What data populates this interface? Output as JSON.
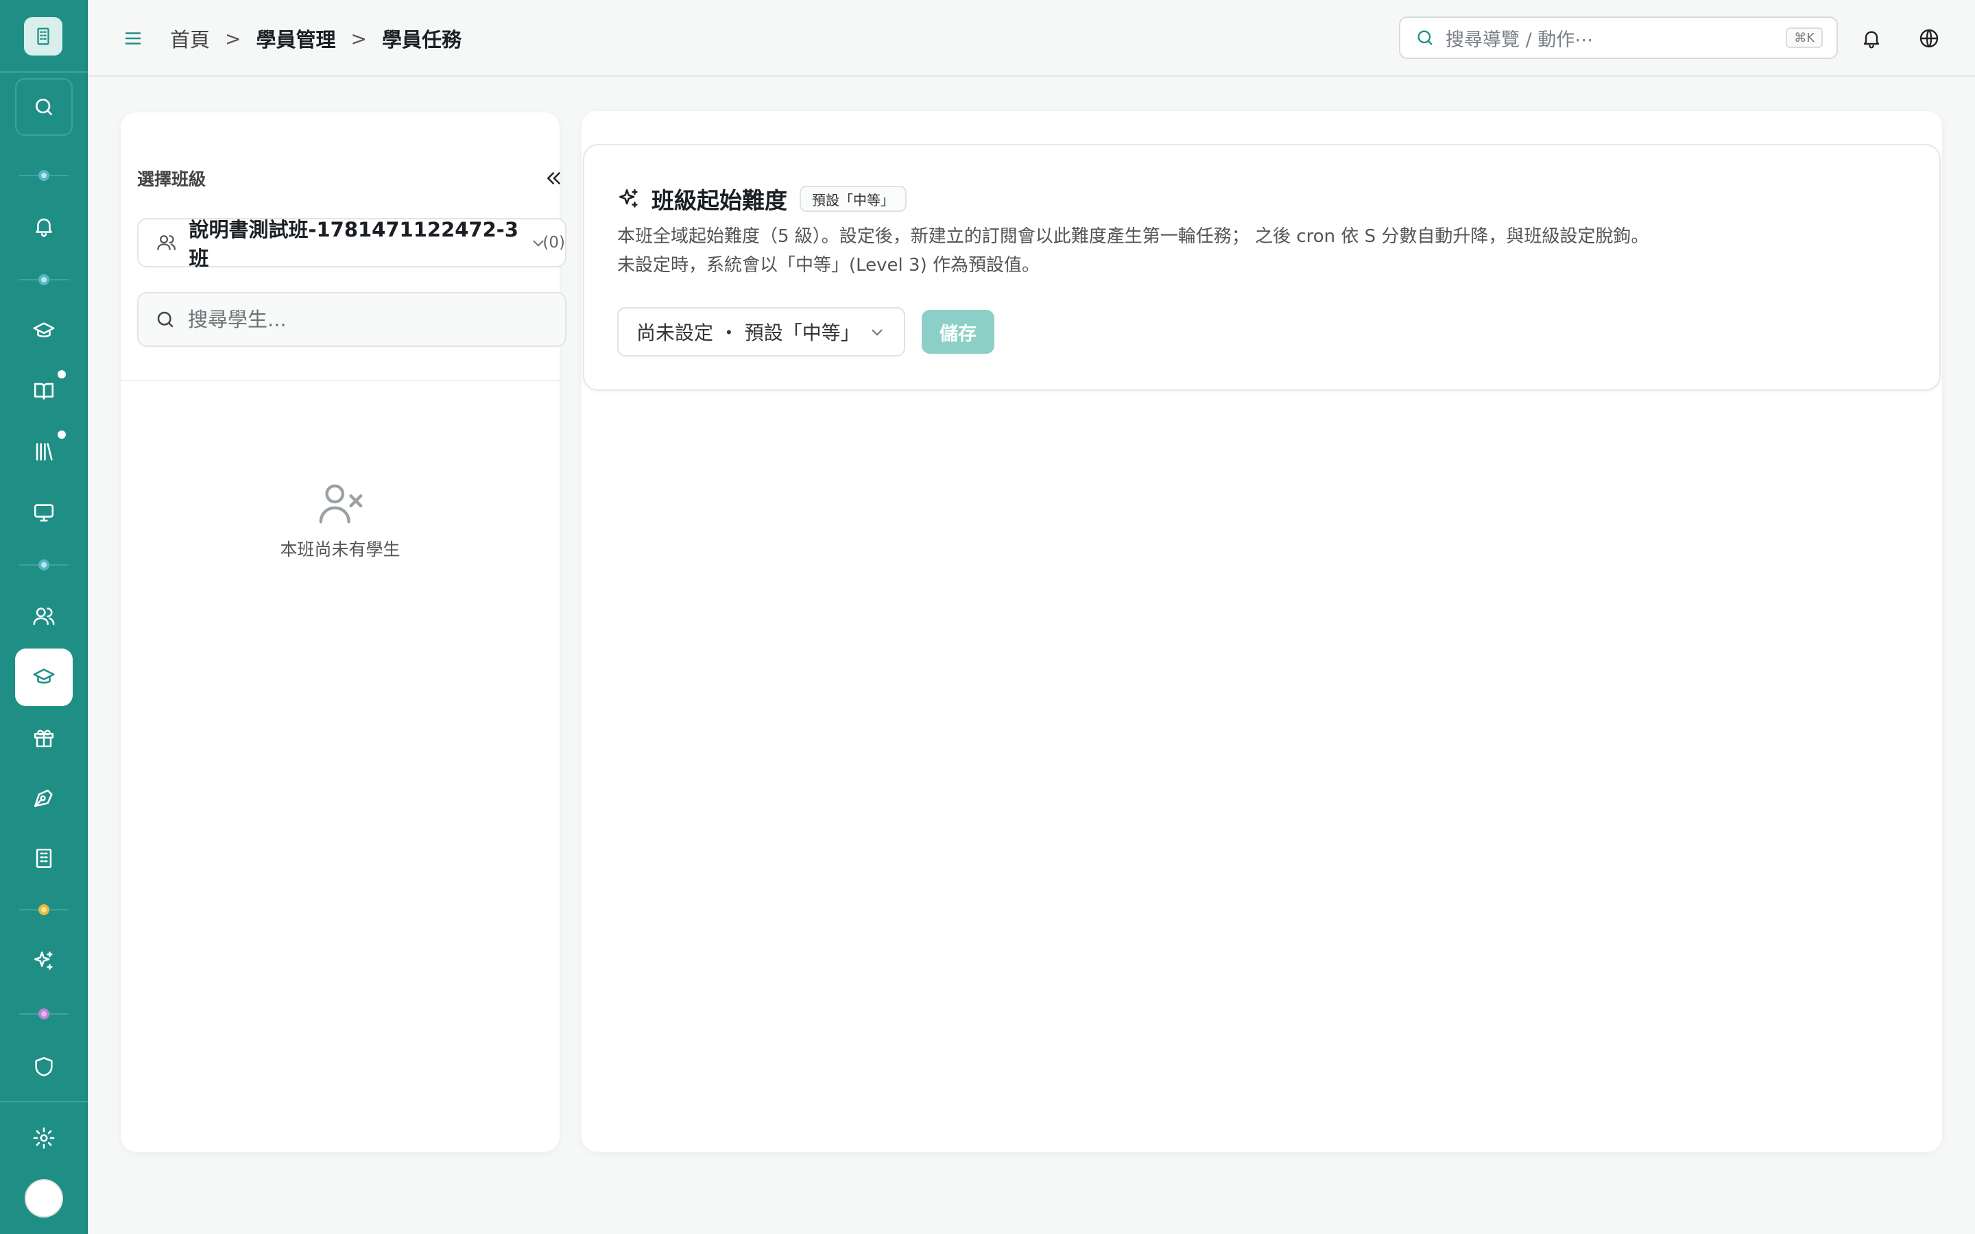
{
  "breadcrumb": {
    "home": "首頁",
    "section": "學員管理",
    "current": "學員任務",
    "separator": ">"
  },
  "global_search": {
    "placeholder": "搜尋導覽 / 動作⋯",
    "shortcut": "⌘K"
  },
  "left_panel": {
    "label": "選擇班級",
    "class_name": "說明書測試班-1781471122472-3班",
    "class_count": "(0)",
    "student_search_placeholder": "搜尋學生...",
    "empty_text": "本班尚未有學生"
  },
  "card": {
    "title": "班級起始難度",
    "tag": "預設「中等」",
    "desc_line1": "本班全域起始難度（5 級）。設定後，新建立的訂閱會以此難度產生第一輪任務； 之後 cron 依 S 分數自動升降，與班級設定脫鉤。",
    "desc_line2": "未設定時，系統會以「中等」(Level 3) 作為預設值。",
    "select_value": "尚未設定 ・ 預設「中等」",
    "save_label": "儲存"
  },
  "colors": {
    "rail": "#1f8f86",
    "accent": "#1f8f86",
    "save_disabled": "#8ccfc6"
  }
}
